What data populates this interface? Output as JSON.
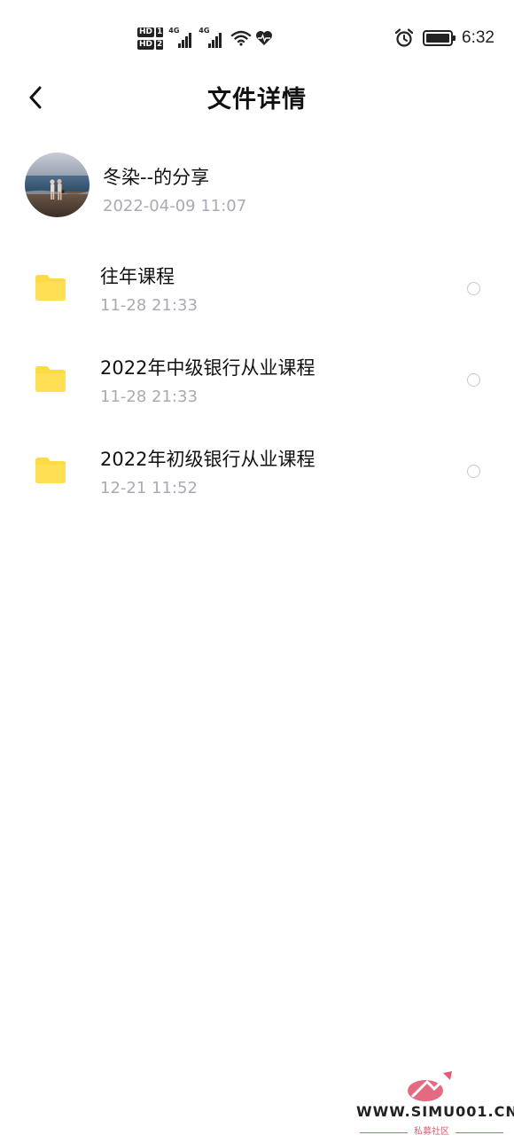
{
  "status_bar": {
    "sim1_badge": "HD",
    "sim1_num": "1",
    "sim2_badge": "HD",
    "sim2_num": "2",
    "sig1_type": "4G",
    "sig2_type": "4G",
    "time": "6:32",
    "battery_level": 1.0,
    "icons": [
      "wifi-icon",
      "heart-rate-icon",
      "alarm-icon",
      "battery-icon"
    ]
  },
  "header": {
    "title": "文件详情",
    "back_icon": "chevron-left-icon"
  },
  "share": {
    "sharer": "冬染--的分享",
    "time": "2022-04-09  11:07"
  },
  "files": [
    {
      "name": "往年课程",
      "time": "11-28  21:33",
      "icon": "folder-icon",
      "selected": false
    },
    {
      "name": "2022年中级银行从业课程",
      "time": "11-28  21:33",
      "icon": "folder-icon",
      "selected": false
    },
    {
      "name": "2022年初级银行从业课程",
      "time": "12-21  11:52",
      "icon": "folder-icon",
      "selected": false
    }
  ],
  "watermark": {
    "url": "WWW.SIMU001.CN",
    "subtitle": "私募社区"
  },
  "colors": {
    "folder": "#fddb45",
    "muted_text": "#a9aab4",
    "watermark_accent": "#e05a72"
  }
}
